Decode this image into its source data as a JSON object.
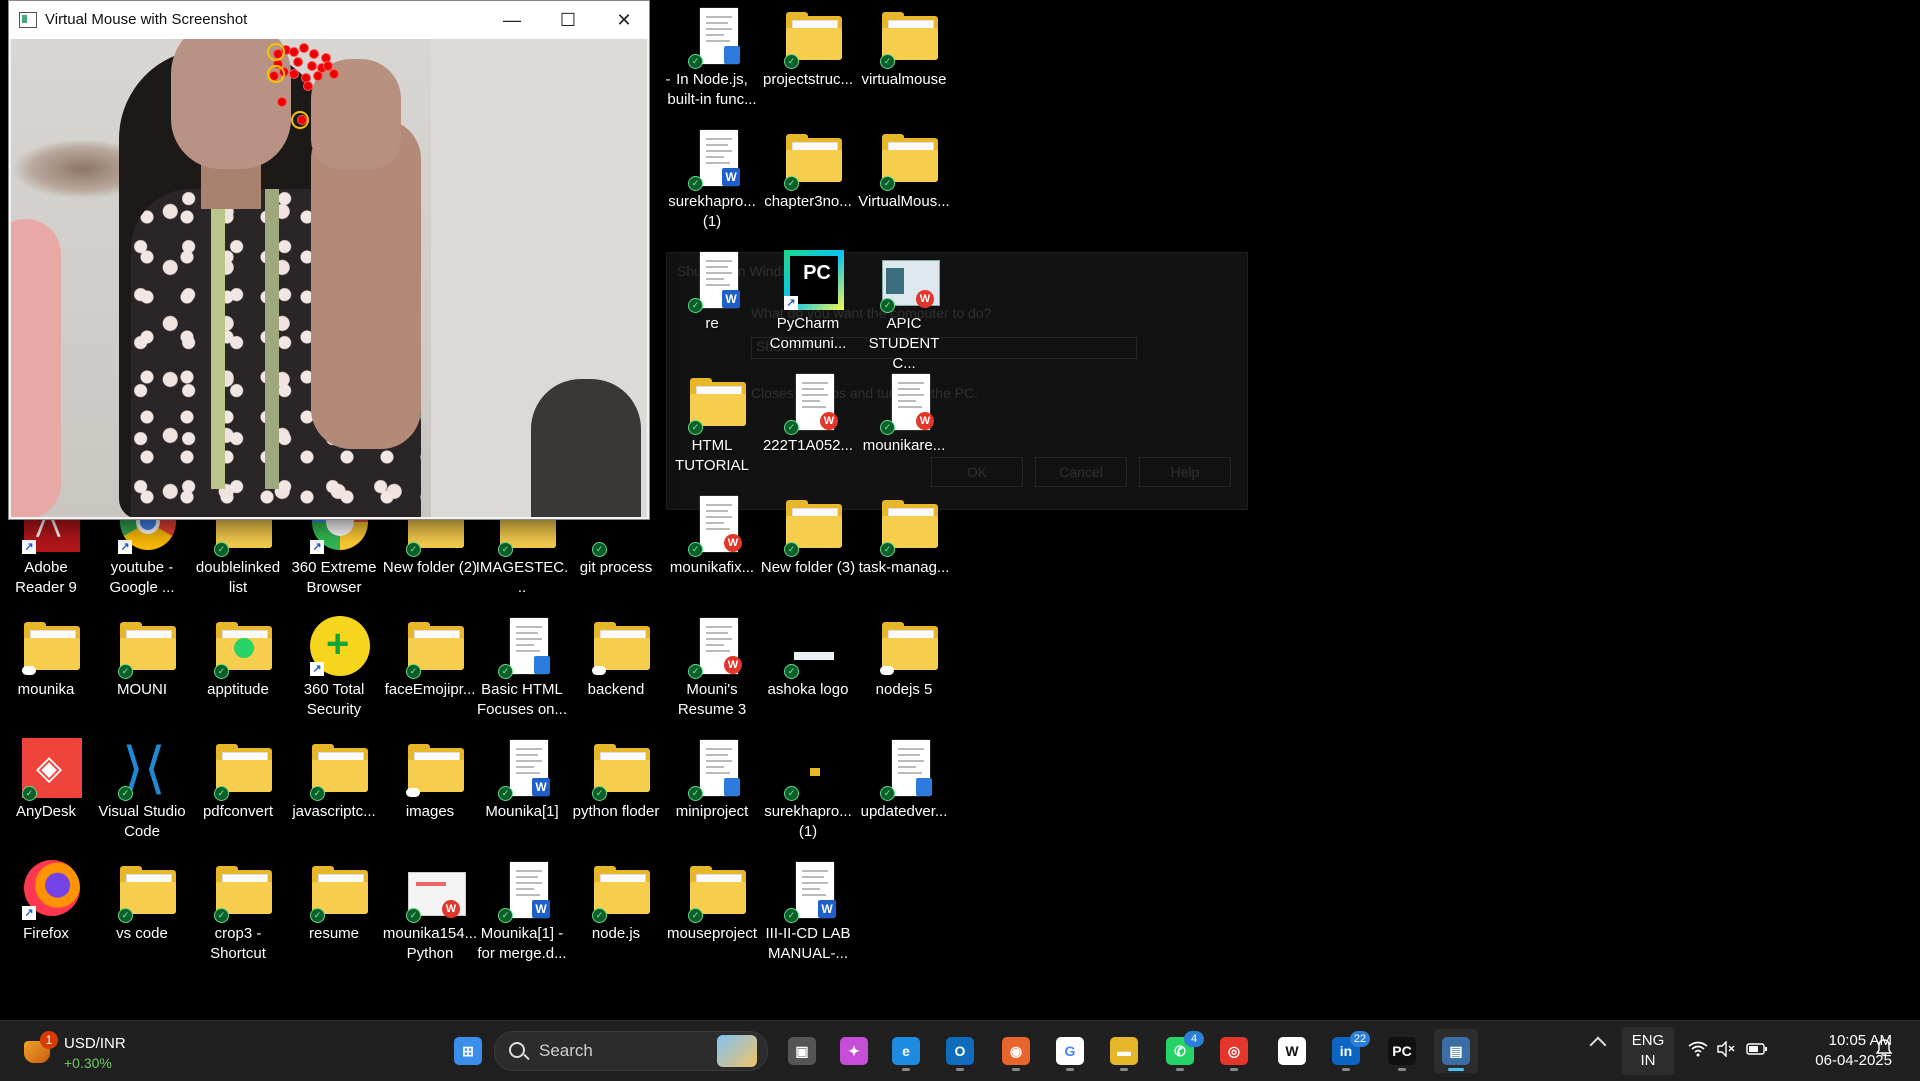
{
  "window": {
    "title": "Virtual Mouse with Screenshot",
    "minimize": "—",
    "maximize": "☐",
    "close": "✕"
  },
  "dialog": {
    "title": "Shut Down Windows",
    "question": "What do you want the computer to do?",
    "selected": "Shut down",
    "description": "Closes all apps and turns off the PC.",
    "ok": "OK",
    "cancel": "Cancel",
    "help": "Help"
  },
  "desktop": {
    "icons": [
      {
        "label": "-",
        "type": "none"
      },
      {
        "label": "In Node.js, built-in func...",
        "type": "doc-note"
      },
      {
        "label": "projectstruc...",
        "type": "folder"
      },
      {
        "label": "virtualmouse",
        "type": "folder"
      },
      {
        "label": "surekhapro... (1)",
        "type": "doc-word"
      },
      {
        "label": "chapter3no...",
        "type": "folder"
      },
      {
        "label": "VirtualMous...",
        "type": "folder"
      },
      {
        "label": "re",
        "type": "doc-word"
      },
      {
        "label": "PyCharm Communi...",
        "type": "pycharm"
      },
      {
        "label": "APIC STUDENT C...",
        "type": "image"
      },
      {
        "label": "HTML TUTORIAL",
        "type": "folder"
      },
      {
        "label": "222T1A052...",
        "type": "doc-wps"
      },
      {
        "label": "mounikare...",
        "type": "doc-wps"
      },
      {
        "label": "Adobe Reader 9",
        "type": "adobe"
      },
      {
        "label": "youtube - Google ...",
        "type": "chrome"
      },
      {
        "label": "doublelinked list",
        "type": "folder"
      },
      {
        "label": "360 Extreme Browser",
        "type": "browser360"
      },
      {
        "label": "New folder (2)",
        "type": "folder"
      },
      {
        "label": "IMAGESTEC...",
        "type": "folder"
      },
      {
        "label": "git process",
        "type": "folder-small"
      },
      {
        "label": "mounikafix...",
        "type": "doc-wps"
      },
      {
        "label": "New folder (3)",
        "type": "folder"
      },
      {
        "label": "task-manag...",
        "type": "folder"
      },
      {
        "label": "mounika",
        "type": "folder"
      },
      {
        "label": "MOUNI",
        "type": "folder"
      },
      {
        "label": "apptitude",
        "type": "folder-whatsapp"
      },
      {
        "label": "360 Total Security",
        "type": "security360"
      },
      {
        "label": "faceEmojipr...",
        "type": "folder"
      },
      {
        "label": "Basic HTML Focuses on...",
        "type": "doc-note"
      },
      {
        "label": "backend",
        "type": "folder"
      },
      {
        "label": "Mouni's Resume 3",
        "type": "doc-wps"
      },
      {
        "label": "ashoka logo",
        "type": "image-small"
      },
      {
        "label": "nodejs 5",
        "type": "folder"
      },
      {
        "label": "AnyDesk",
        "type": "anydesk"
      },
      {
        "label": "Visual Studio Code",
        "type": "vscode"
      },
      {
        "label": "pdfconvert",
        "type": "folder"
      },
      {
        "label": "javascriptc...",
        "type": "folder"
      },
      {
        "label": "images",
        "type": "folder"
      },
      {
        "label": "Mounika[1]",
        "type": "doc-word"
      },
      {
        "label": "python floder",
        "type": "folder"
      },
      {
        "label": "miniproject",
        "type": "doc-note"
      },
      {
        "label": "surekhapro... (1)",
        "type": "tiny"
      },
      {
        "label": "updatedver...",
        "type": "doc-note"
      },
      {
        "label": "Firefox",
        "type": "firefox"
      },
      {
        "label": "vs code",
        "type": "folder"
      },
      {
        "label": "crop3 - Shortcut",
        "type": "folder"
      },
      {
        "label": "resume",
        "type": "folder"
      },
      {
        "label": "mounika154... Python",
        "type": "image-wps"
      },
      {
        "label": "Mounika[1] - for merge.d...",
        "type": "doc-word"
      },
      {
        "label": "node.js",
        "type": "folder"
      },
      {
        "label": "mouseproject",
        "type": "folder"
      },
      {
        "label": "III-II-CD LAB MANUAL-...",
        "type": "doc-word"
      }
    ]
  },
  "taskbar": {
    "widget": {
      "badge": "1",
      "title": "USD/INR",
      "change": "+0.30%"
    },
    "search_placeholder": "Search",
    "apps": [
      {
        "name": "start",
        "glyph": "⊞",
        "color": "#3b8eea"
      },
      {
        "name": "task-view",
        "glyph": "▣",
        "color": "#555"
      },
      {
        "name": "copilot",
        "glyph": "✦",
        "color": "#c44fd6"
      },
      {
        "name": "edge",
        "glyph": "e",
        "color": "#1f8be0"
      },
      {
        "name": "outlook",
        "glyph": "O",
        "color": "#0f6cbd"
      },
      {
        "name": "firefox",
        "glyph": "◉",
        "color": "#e8662b"
      },
      {
        "name": "google",
        "glyph": "G",
        "color": "#ffffff"
      },
      {
        "name": "file-explorer",
        "glyph": "▬",
        "color": "#e7b529"
      },
      {
        "name": "whatsapp",
        "glyph": "✆",
        "color": "#25d366",
        "badge": "4"
      },
      {
        "name": "chrome",
        "glyph": "◎",
        "color": "#e5362c"
      },
      {
        "name": "wikipedia",
        "glyph": "W",
        "color": "#ffffff"
      },
      {
        "name": "linkedin",
        "glyph": "in",
        "color": "#0a66c2",
        "badge": "22"
      },
      {
        "name": "pycharm",
        "glyph": "PC",
        "color": "#111111"
      },
      {
        "name": "python",
        "glyph": "▤",
        "color": "#3a6ea5"
      }
    ],
    "lang": {
      "line1": "ENG",
      "line2": "IN"
    },
    "time": "10:05 AM",
    "date": "06-04-2025"
  }
}
